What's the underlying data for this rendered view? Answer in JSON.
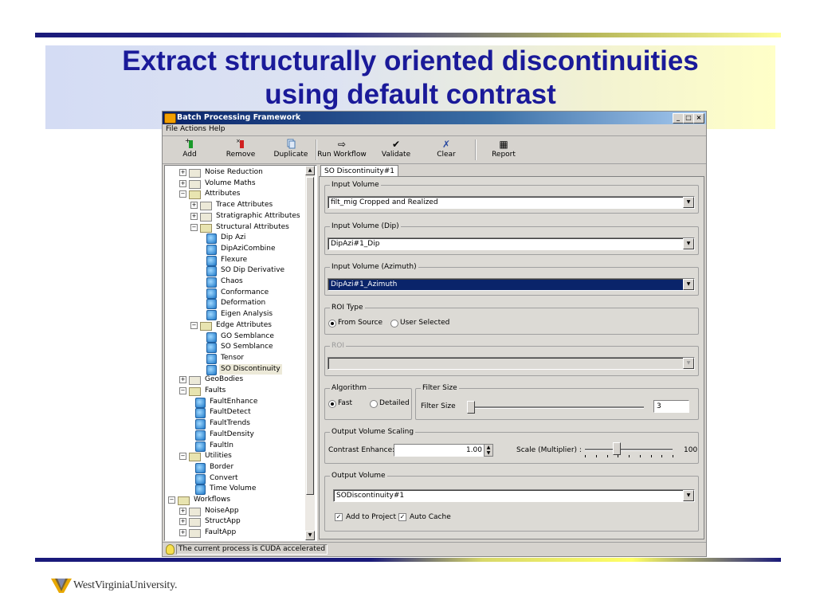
{
  "slide": {
    "title_line1": "Extract structurally oriented discontinuities",
    "title_line2": "using default contrast",
    "footer_logo_text": "WestVirginiaUniversity."
  },
  "window": {
    "title": "Batch Processing Framework",
    "controls": [
      "_",
      "□",
      "×"
    ]
  },
  "menu": [
    "File",
    "Actions",
    "Help"
  ],
  "toolbar": {
    "add": "Add",
    "remove": "Remove",
    "duplicate": "Duplicate",
    "run_workflow": "Run Workflow",
    "validate": "Validate",
    "clear": "Clear",
    "report": "Report"
  },
  "tree": [
    {
      "label": "Noise Reduction",
      "kind": "folder",
      "expander": "+",
      "level": 1
    },
    {
      "label": "Volume Maths",
      "kind": "folder",
      "expander": "+",
      "level": 1
    },
    {
      "label": "Attributes",
      "kind": "folder-open",
      "expander": "−",
      "level": 1
    },
    {
      "label": "Trace Attributes",
      "kind": "folder",
      "expander": "+",
      "level": 2
    },
    {
      "label": "Stratigraphic Attributes",
      "kind": "folder",
      "expander": "+",
      "level": 2
    },
    {
      "label": "Structural Attributes",
      "kind": "folder-open",
      "expander": "−",
      "level": 2
    },
    {
      "label": "Dip Azi",
      "kind": "item",
      "level": 3
    },
    {
      "label": "DipAziCombine",
      "kind": "item",
      "level": 3
    },
    {
      "label": "Flexure",
      "kind": "item",
      "level": 3
    },
    {
      "label": "SO Dip Derivative",
      "kind": "item",
      "level": 3
    },
    {
      "label": "Chaos",
      "kind": "item",
      "level": 3
    },
    {
      "label": "Conformance",
      "kind": "item",
      "level": 3
    },
    {
      "label": "Deformation",
      "kind": "item",
      "level": 3
    },
    {
      "label": "Eigen Analysis",
      "kind": "item",
      "level": 3
    },
    {
      "label": "Edge Attributes",
      "kind": "folder-open",
      "expander": "−",
      "level": 2
    },
    {
      "label": "GO Semblance",
      "kind": "item",
      "level": 3
    },
    {
      "label": "SO Semblance",
      "kind": "item",
      "level": 3
    },
    {
      "label": "Tensor",
      "kind": "item",
      "level": 3
    },
    {
      "label": "SO Discontinuity",
      "kind": "item",
      "level": 3,
      "selected": true
    },
    {
      "label": "GeoBodies",
      "kind": "folder",
      "expander": "+",
      "level": 1
    },
    {
      "label": "Faults",
      "kind": "folder-open",
      "expander": "−",
      "level": 1
    },
    {
      "label": "FaultEnhance",
      "kind": "item",
      "level": 2
    },
    {
      "label": "FaultDetect",
      "kind": "item",
      "level": 2
    },
    {
      "label": "FaultTrends",
      "kind": "item",
      "level": 2
    },
    {
      "label": "FaultDensity",
      "kind": "item",
      "level": 2
    },
    {
      "label": "FaultIn",
      "kind": "item",
      "level": 2
    },
    {
      "label": "Utilities",
      "kind": "folder-open",
      "expander": "−",
      "level": 1
    },
    {
      "label": "Border",
      "kind": "item",
      "level": 2
    },
    {
      "label": "Convert",
      "kind": "item",
      "level": 2
    },
    {
      "label": "Time Volume",
      "kind": "item",
      "level": 2
    },
    {
      "label": "Workflows",
      "kind": "folder-open",
      "expander": "−",
      "level": 0
    },
    {
      "label": "NoiseApp",
      "kind": "folder",
      "expander": "+",
      "level": 1
    },
    {
      "label": "StructApp",
      "kind": "folder",
      "expander": "+",
      "level": 1
    },
    {
      "label": "FaultApp",
      "kind": "folder",
      "expander": "+",
      "level": 1
    }
  ],
  "tab": {
    "label": "SO Discontinuity#1"
  },
  "form": {
    "input_volume": {
      "label": "Input Volume",
      "value": "filt_mig Cropped and Realized"
    },
    "input_volume_dip": {
      "label": "Input Volume (Dip)",
      "value": "DipAzi#1_Dip"
    },
    "input_volume_azimuth": {
      "label": "Input Volume (Azimuth)",
      "value": "DipAzi#1_Azimuth"
    },
    "roi_type": {
      "label": "ROI Type",
      "options": [
        "From Source",
        "User Selected"
      ],
      "selected": "From Source"
    },
    "roi": {
      "label": "ROI",
      "value": ""
    },
    "algorithm": {
      "label": "Algorithm",
      "options": [
        "Fast",
        "Detailed"
      ],
      "selected": "Fast"
    },
    "filter_size": {
      "group_label": "Filter Size",
      "label": "Filter Size",
      "value": "3",
      "slider_fraction": 0.0
    },
    "output_scaling": {
      "label": "Output Volume Scaling",
      "contrast_label": "Contrast Enhance:",
      "contrast_value": "1.00",
      "scale_label": "Scale (Multiplier) :",
      "scale_value": "100",
      "scale_slider_fraction": 0.35
    },
    "output_volume": {
      "label": "Output Volume",
      "value": "SODiscontinuity#1"
    },
    "add_to_project": {
      "label": "Add to Project",
      "checked": true
    },
    "auto_cache": {
      "label": "Auto Cache",
      "checked": true
    }
  },
  "status": {
    "text": "The current process is CUDA accelerated"
  },
  "icons": {
    "add": "add-icon",
    "remove": "remove-icon",
    "duplicate": "duplicate-icon",
    "run": "arrow-right-icon",
    "validate": "checkmark-icon",
    "clear": "x-icon",
    "report": "report-icon"
  },
  "colors": {
    "title_text": "#1a1a99",
    "selection": "#0a246a",
    "titlebar": "#0a246a"
  }
}
